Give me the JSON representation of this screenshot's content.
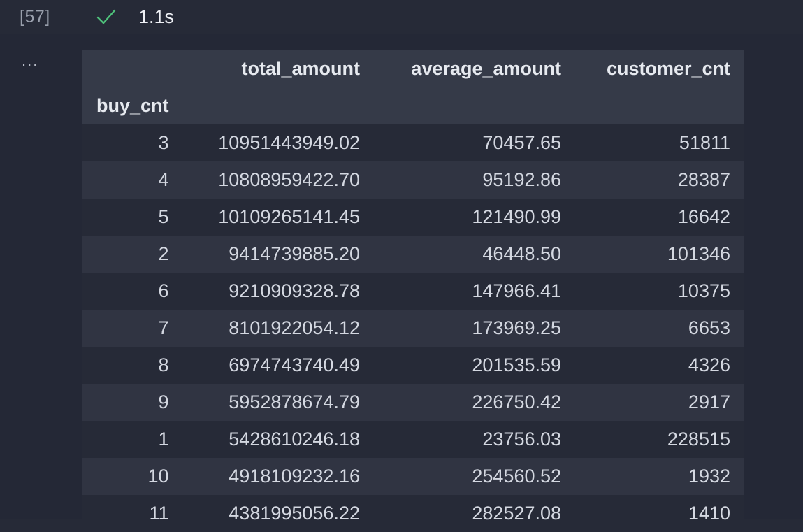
{
  "cell": {
    "execution_count": "[57]",
    "status_icon": "check-icon",
    "exec_time": "1.1s",
    "status_color": "#4ec07a"
  },
  "output": {
    "more_icon": "ellipsis-icon",
    "more_label": "...",
    "table": {
      "columns": [
        "total_amount",
        "average_amount",
        "customer_cnt"
      ],
      "index_name": "buy_cnt",
      "rows": [
        {
          "index": "3",
          "values": [
            "10951443949.02",
            "70457.65",
            "51811"
          ]
        },
        {
          "index": "4",
          "values": [
            "10808959422.70",
            "95192.86",
            "28387"
          ]
        },
        {
          "index": "5",
          "values": [
            "10109265141.45",
            "121490.99",
            "16642"
          ]
        },
        {
          "index": "2",
          "values": [
            "9414739885.20",
            "46448.50",
            "101346"
          ]
        },
        {
          "index": "6",
          "values": [
            "9210909328.78",
            "147966.41",
            "10375"
          ]
        },
        {
          "index": "7",
          "values": [
            "8101922054.12",
            "173969.25",
            "6653"
          ]
        },
        {
          "index": "8",
          "values": [
            "6974743740.49",
            "201535.59",
            "4326"
          ]
        },
        {
          "index": "9",
          "values": [
            "5952878674.79",
            "226750.42",
            "2917"
          ]
        },
        {
          "index": "1",
          "values": [
            "5428610246.18",
            "23756.03",
            "228515"
          ]
        },
        {
          "index": "10",
          "values": [
            "4918109232.16",
            "254560.52",
            "1932"
          ]
        },
        {
          "index": "11",
          "values": [
            "4381995056.22",
            "282527.08",
            "1410"
          ]
        }
      ]
    }
  }
}
